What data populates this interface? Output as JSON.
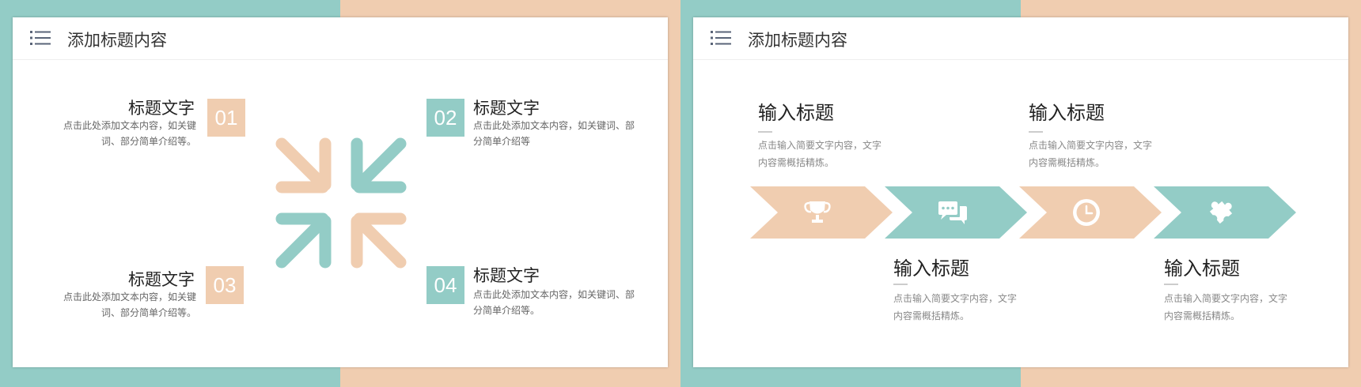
{
  "colors": {
    "teal": "#93ccc6",
    "peach": "#f0cdb0"
  },
  "left_slide": {
    "title": "添加标题内容",
    "items": [
      {
        "number": "01",
        "title": "标题文字",
        "desc": "点击此处添加文本内容，如关键词、部分简单介绍等。",
        "color": "peach"
      },
      {
        "number": "02",
        "title": "标题文字",
        "desc": "点击此处添加文本内容，如关键词、部分简单介绍等",
        "color": "teal"
      },
      {
        "number": "03",
        "title": "标题文字",
        "desc": "点击此处添加文本内容，如关键词、部分简单介绍等。",
        "color": "peach"
      },
      {
        "number": "04",
        "title": "标题文字",
        "desc": "点击此处添加文本内容，如关键词、部分简单介绍等。",
        "color": "teal"
      }
    ],
    "center_graphic": "four-arrows-converging"
  },
  "right_slide": {
    "title": "添加标题内容",
    "steps": [
      {
        "title": "输入标题",
        "desc": "点击输入简要文字内容，文字内容需概括精炼。",
        "icon": "trophy-icon",
        "color": "peach"
      },
      {
        "title": "输入标题",
        "desc": "点击输入简要文字内容，文字内容需概括精炼。",
        "icon": "chat-icon",
        "color": "teal"
      },
      {
        "title": "输入标题",
        "desc": "点击输入简要文字内容，文字内容需概括精炼。",
        "icon": "clock-icon",
        "color": "peach"
      },
      {
        "title": "输入标题",
        "desc": "点击输入简要文字内容，文字内容需概括精炼。",
        "icon": "puzzle-icon",
        "color": "teal"
      }
    ]
  }
}
